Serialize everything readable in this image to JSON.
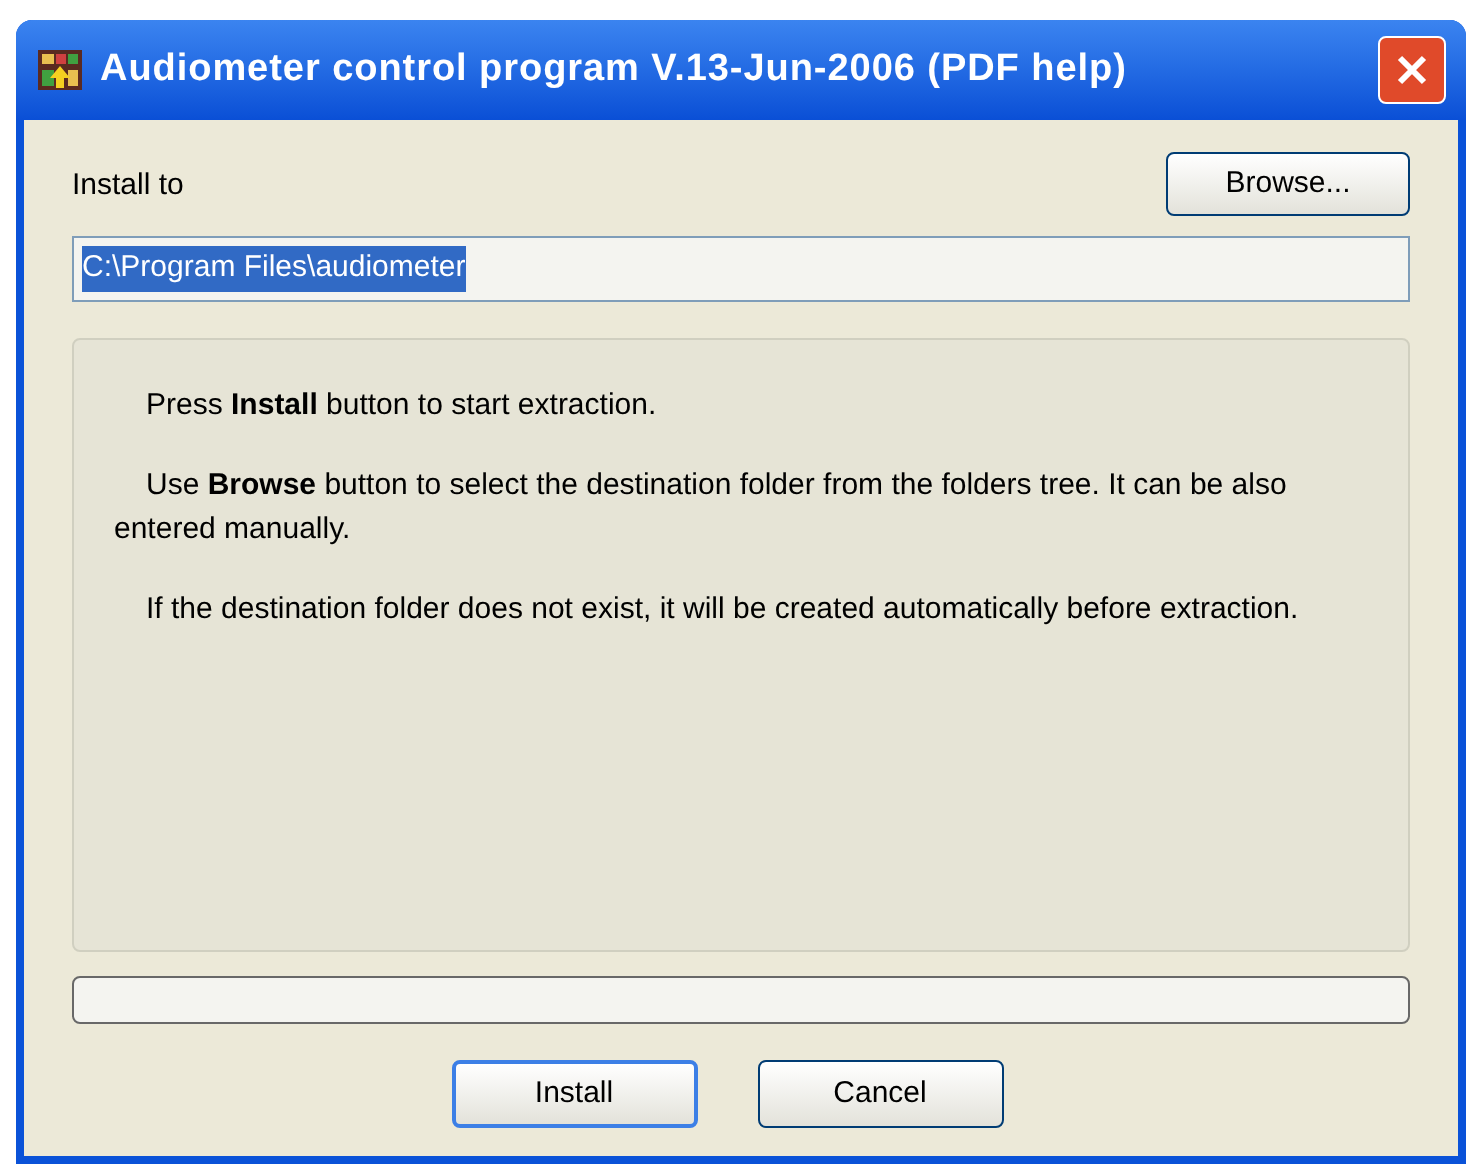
{
  "window": {
    "title": "Audiometer control program V.13-Jun-2006 (PDF help)"
  },
  "install_to": {
    "label": "Install to",
    "value": "C:\\Program Files\\audiometer",
    "text_selected": true
  },
  "browse_button": "Browse...",
  "message": [
    "Press **Install** button to start extraction.",
    "Use **Browse** button to select the destination folder from the folders tree. It can be also entered manually.",
    "If the destination folder does not exist, it will be created automatically before extraction."
  ],
  "progress": {
    "level": 0
  },
  "buttons": [
    {
      "label": "Install",
      "default": true
    },
    {
      "label": "Cancel",
      "default": false
    }
  ]
}
